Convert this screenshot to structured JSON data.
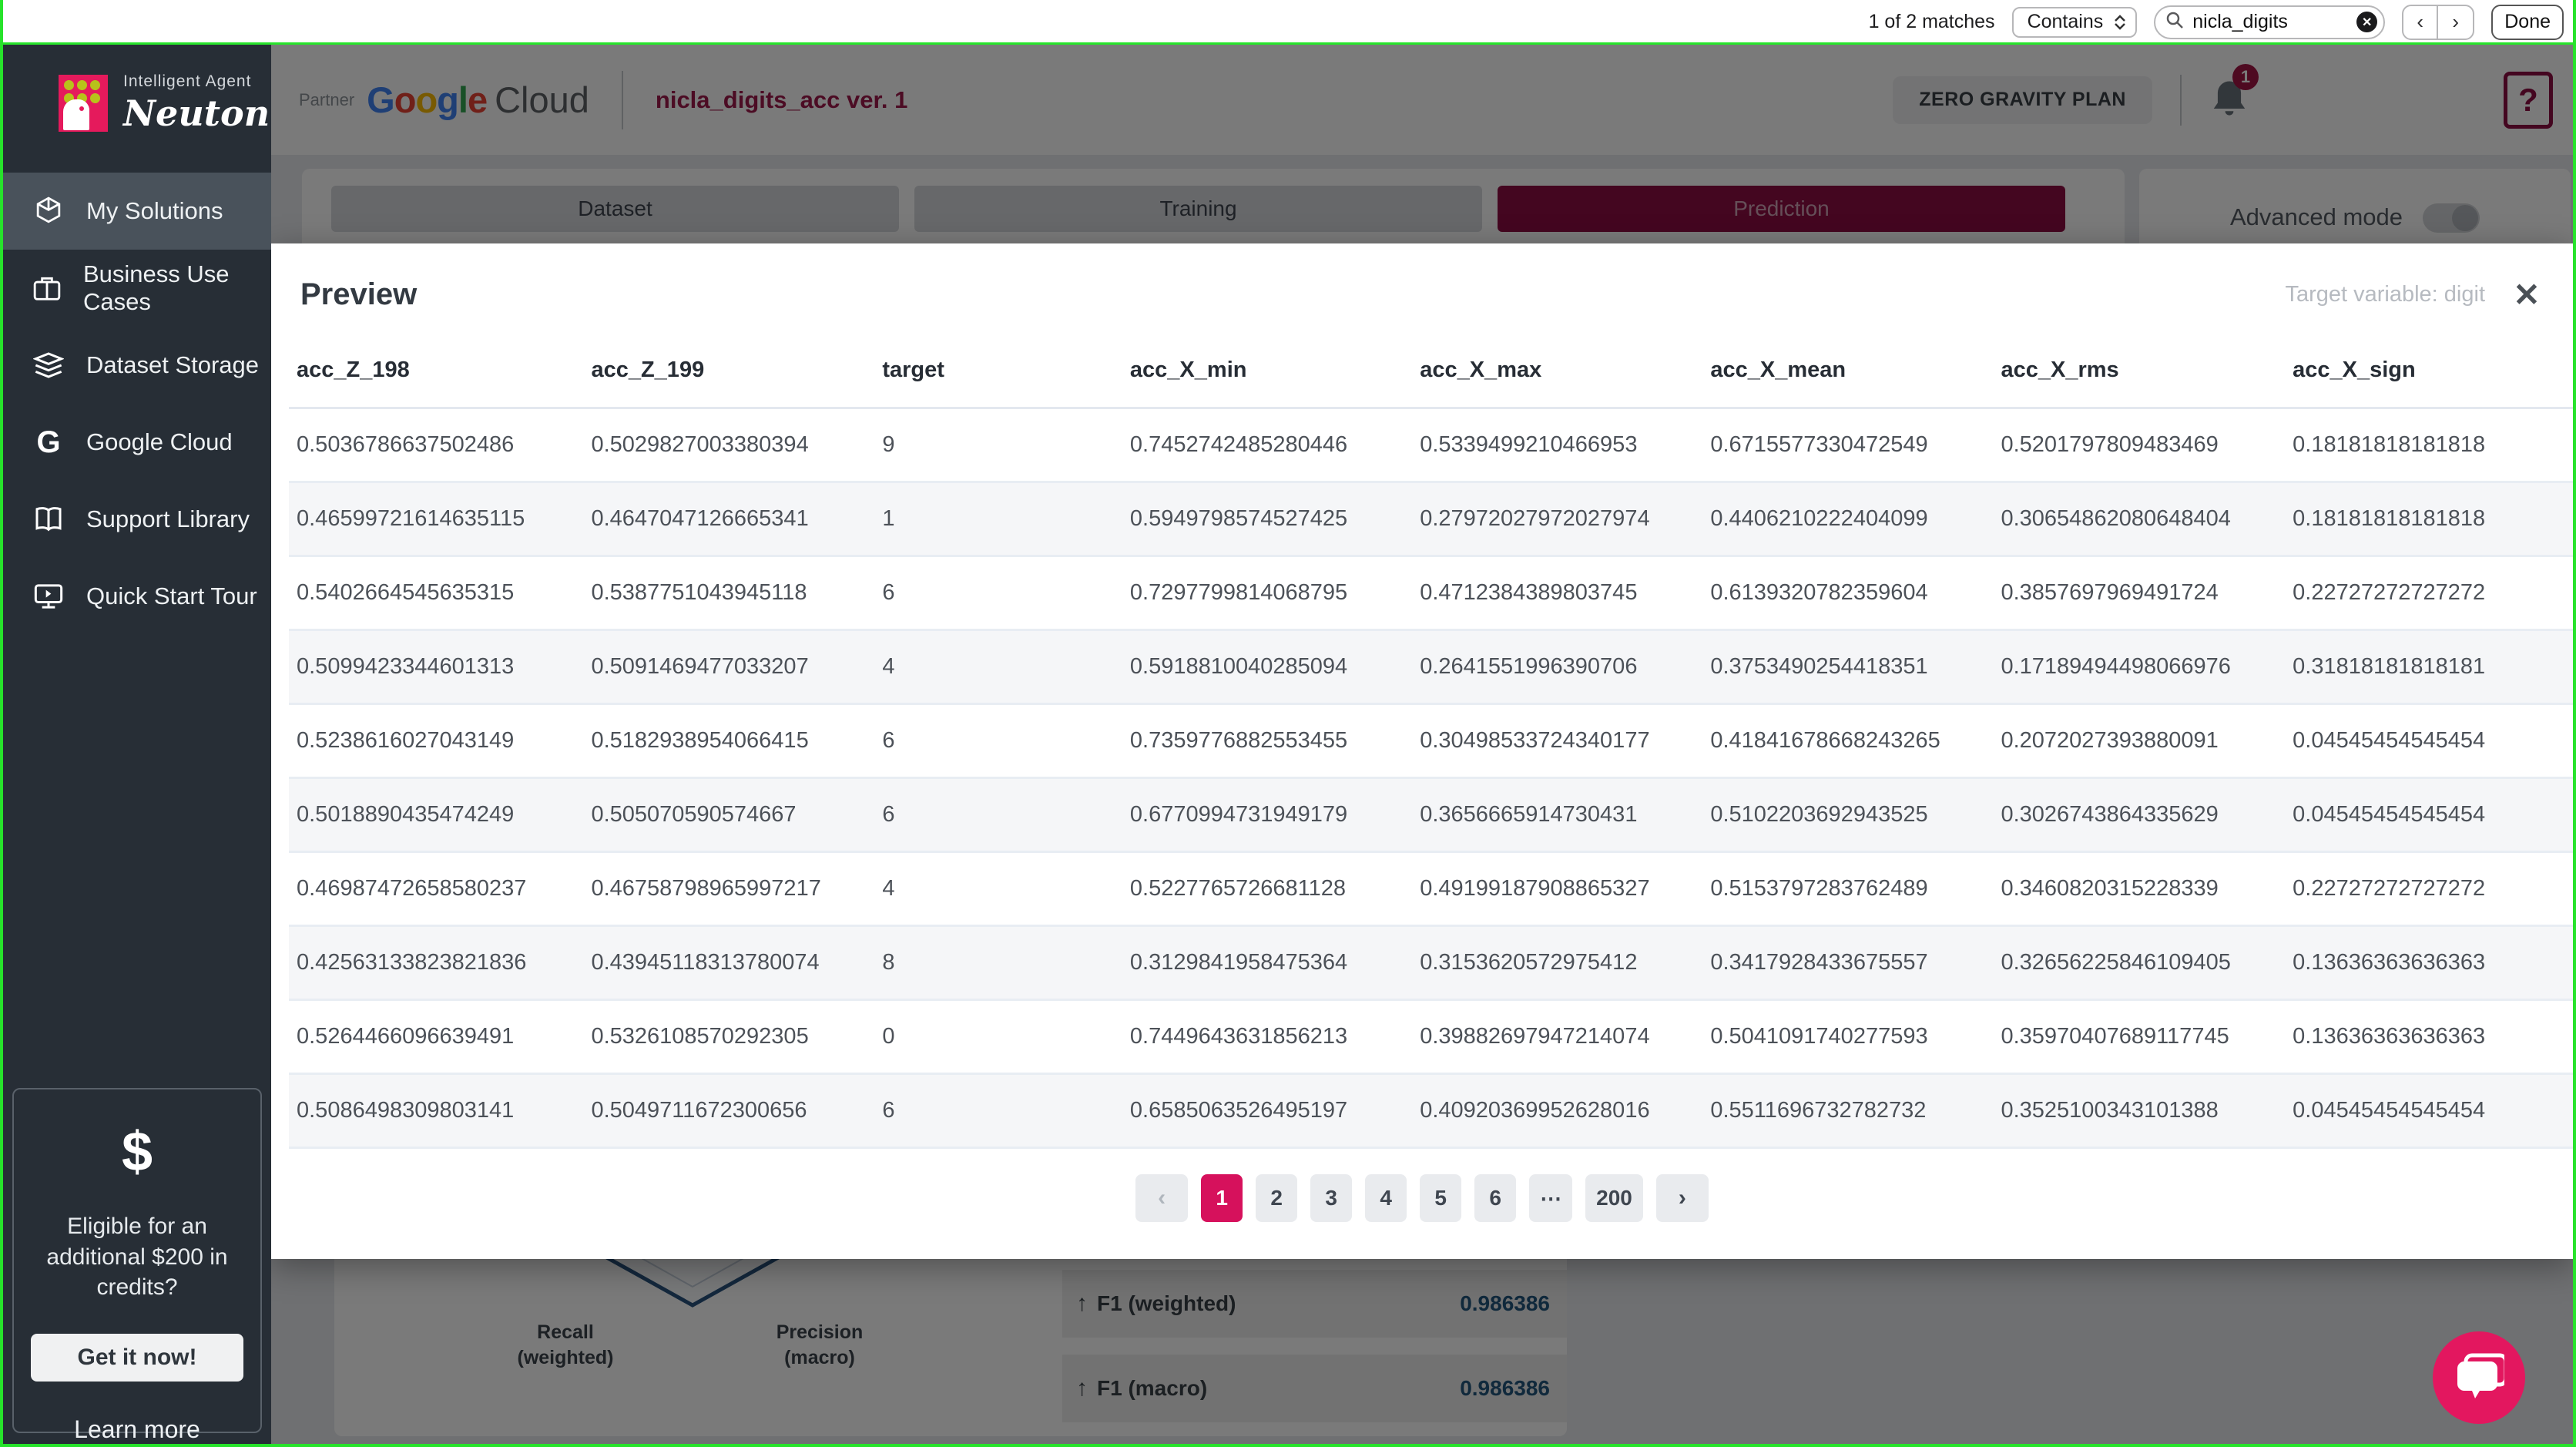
{
  "findbar": {
    "matches": "1 of 2 matches",
    "mode": "Contains",
    "query": "nicla_digits",
    "done_label": "Done"
  },
  "sidebar": {
    "brand_top": "Intelligent Agent",
    "brand_name": "Neuton",
    "items": [
      {
        "label": "My Solutions",
        "icon": "cube-icon",
        "active": true
      },
      {
        "label": "Business Use Cases",
        "icon": "briefcase-icon",
        "active": false
      },
      {
        "label": "Dataset Storage",
        "icon": "layers-icon",
        "active": false
      },
      {
        "label": "Google Cloud",
        "icon": "google-g-icon",
        "active": false
      },
      {
        "label": "Support Library",
        "icon": "book-icon",
        "active": false
      },
      {
        "label": "Quick Start Tour",
        "icon": "tour-icon",
        "active": false
      }
    ],
    "credits": {
      "icon": "dollar-icon",
      "text": "Eligible for an additional $200 in credits?",
      "button_label": "Get it now!",
      "link_label": "Learn more"
    }
  },
  "header": {
    "partner": "Partner",
    "google_letters": [
      "G",
      "o",
      "o",
      "g",
      "l",
      "e"
    ],
    "google_colors": [
      "#4285F4",
      "#EA4335",
      "#FBBC05",
      "#4285F4",
      "#34A853",
      "#EA4335"
    ],
    "cloud": "Cloud",
    "project_title": "nicla_digits_acc ver. 1",
    "plan_label": "ZERO GRAVITY PLAN",
    "bell_badge": "1",
    "help_label": "?"
  },
  "tabs": [
    {
      "label": "Dataset",
      "active": false
    },
    {
      "label": "Training",
      "active": false
    },
    {
      "label": "Prediction",
      "active": true
    }
  ],
  "advanced_mode": {
    "label": "Advanced mode",
    "on": false
  },
  "modal": {
    "title": "Preview",
    "target_variable": "Target variable: digit",
    "columns": [
      "acc_Z_198",
      "acc_Z_199",
      "target",
      "acc_X_min",
      "acc_X_max",
      "acc_X_mean",
      "acc_X_rms",
      "acc_X_sign"
    ],
    "rows": [
      [
        "0.5036786637502486",
        "0.5029827003380394",
        "9",
        "0.7452742485280446",
        "0.5339499210466953",
        "0.6715577330472549",
        "0.5201797809483469",
        "0.18181818181818"
      ],
      [
        "0.46599721614635115",
        "0.4647047126665341",
        "1",
        "0.5949798574527425",
        "0.27972027972027974",
        "0.4406210222404099",
        "0.30654862080648404",
        "0.18181818181818"
      ],
      [
        "0.5402664545635315",
        "0.5387751043945118",
        "6",
        "0.7297799814068795",
        "0.4712384389803745",
        "0.6139320782359604",
        "0.3857697969491724",
        "0.22727272727272"
      ],
      [
        "0.5099423344601313",
        "0.5091469477033207",
        "4",
        "0.5918810040285094",
        "0.2641551996390706",
        "0.3753490254418351",
        "0.17189494498066976",
        "0.31818181818181"
      ],
      [
        "0.5238616027043149",
        "0.5182938954066415",
        "6",
        "0.7359776882553455",
        "0.30498533724340177",
        "0.41841678668243265",
        "0.2072027393880091",
        "0.04545454545454"
      ],
      [
        "0.5018890435474249",
        "0.505070590574667",
        "6",
        "0.6770994731949179",
        "0.3656665914730431",
        "0.5102203692943525",
        "0.3026743864335629",
        "0.04545454545454"
      ],
      [
        "0.46987472658580237",
        "0.46758798965997217",
        "4",
        "0.5227765726681128",
        "0.49199187908865327",
        "0.5153797283762489",
        "0.3460820315228339",
        "0.22727272727272"
      ],
      [
        "0.42563133823821836",
        "0.43945118313780074",
        "8",
        "0.3129841958475364",
        "0.3153620572975412",
        "0.3417928433675557",
        "0.32656225846109405",
        "0.13636363636363"
      ],
      [
        "0.5264466096639491",
        "0.5326108570292305",
        "0",
        "0.7449643631856213",
        "0.39882697947214074",
        "0.5041091740277593",
        "0.35970407689117745",
        "0.13636363636363"
      ],
      [
        "0.5086498309803141",
        "0.5049711672300656",
        "6",
        "0.6585063526495197",
        "0.40920369952628016",
        "0.5511696732782732",
        "0.3525100343101388",
        "0.04545454545454"
      ]
    ],
    "pagination": {
      "prev": "‹",
      "pages": [
        "1",
        "2",
        "3",
        "4",
        "5",
        "6",
        "⋯",
        "200"
      ],
      "active": "1",
      "next": "›"
    }
  },
  "metrics": {
    "chart_labels": [
      "Recall (weighted)",
      "Precision (macro)"
    ],
    "rows": [
      {
        "label": "F1 (weighted)",
        "value": "0.986386"
      },
      {
        "label": "F1 (macro)",
        "value": "0.986386"
      }
    ]
  },
  "colors": {
    "accent_maroon": "#8e0e43",
    "pagination_pink": "#d6115c",
    "chat_pink": "#e3175f",
    "value_blue": "#23567d",
    "capture_green": "#27e32b",
    "sidebar_dark": "#272e36"
  }
}
